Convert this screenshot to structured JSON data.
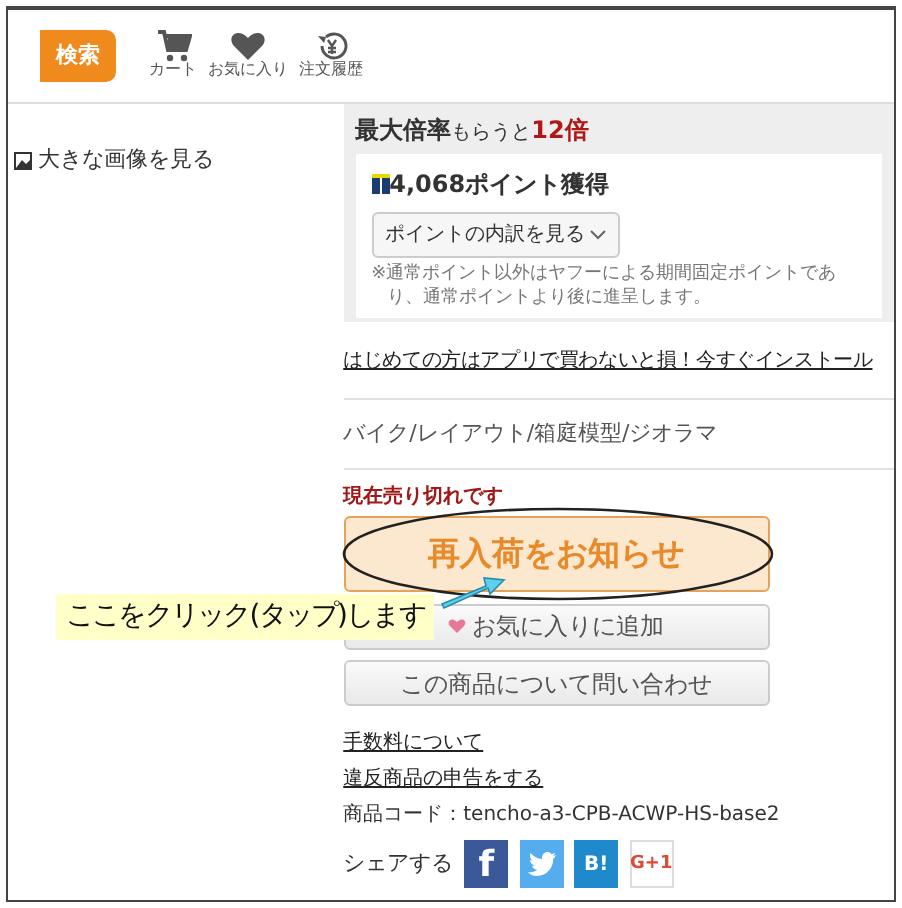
{
  "header": {
    "search_button": "検索",
    "nav": [
      {
        "kind": "cart",
        "label": "カート"
      },
      {
        "kind": "heart",
        "label": "お気に入り"
      },
      {
        "kind": "history",
        "label": "注文履歴"
      }
    ]
  },
  "view_large_image": "大きな画像を見る",
  "points": {
    "title": "最大倍率",
    "title_sub": "もらうと",
    "multiplier": "12倍",
    "earned": "4,068ポイント獲得",
    "breakdown_button": "ポイントの内訳を見る",
    "note": "※通常ポイント以外はヤフーによる期間固定ポイントであり、通常ポイントより後に進呈します。"
  },
  "app_link": "はじめての方はアプリで買わないと損！今すぐインストール",
  "category": "バイク/レイアウト/箱庭模型/ジオラマ",
  "stock_status": "現在売り切れです",
  "buttons": [
    {
      "kind": "restock",
      "label": "再入荷をお知らせ"
    },
    {
      "kind": "favorite",
      "label": "お気に入りに追加"
    },
    {
      "kind": "inquiry",
      "label": "この商品について問い合わせ"
    }
  ],
  "links": [
    "手数料について",
    "違反商品の申告をする"
  ],
  "product_code": "商品コード：tencho-a3-CPB-ACWP-HS-base2",
  "share": {
    "label": "シェアする",
    "buttons": [
      {
        "kind": "facebook",
        "label": "f"
      },
      {
        "kind": "twitter"
      },
      {
        "kind": "hatena",
        "label": "B!"
      },
      {
        "kind": "googleplus",
        "label": "G+1"
      }
    ]
  },
  "annotation": {
    "callout": "ここをクリック(タップ)します"
  }
}
